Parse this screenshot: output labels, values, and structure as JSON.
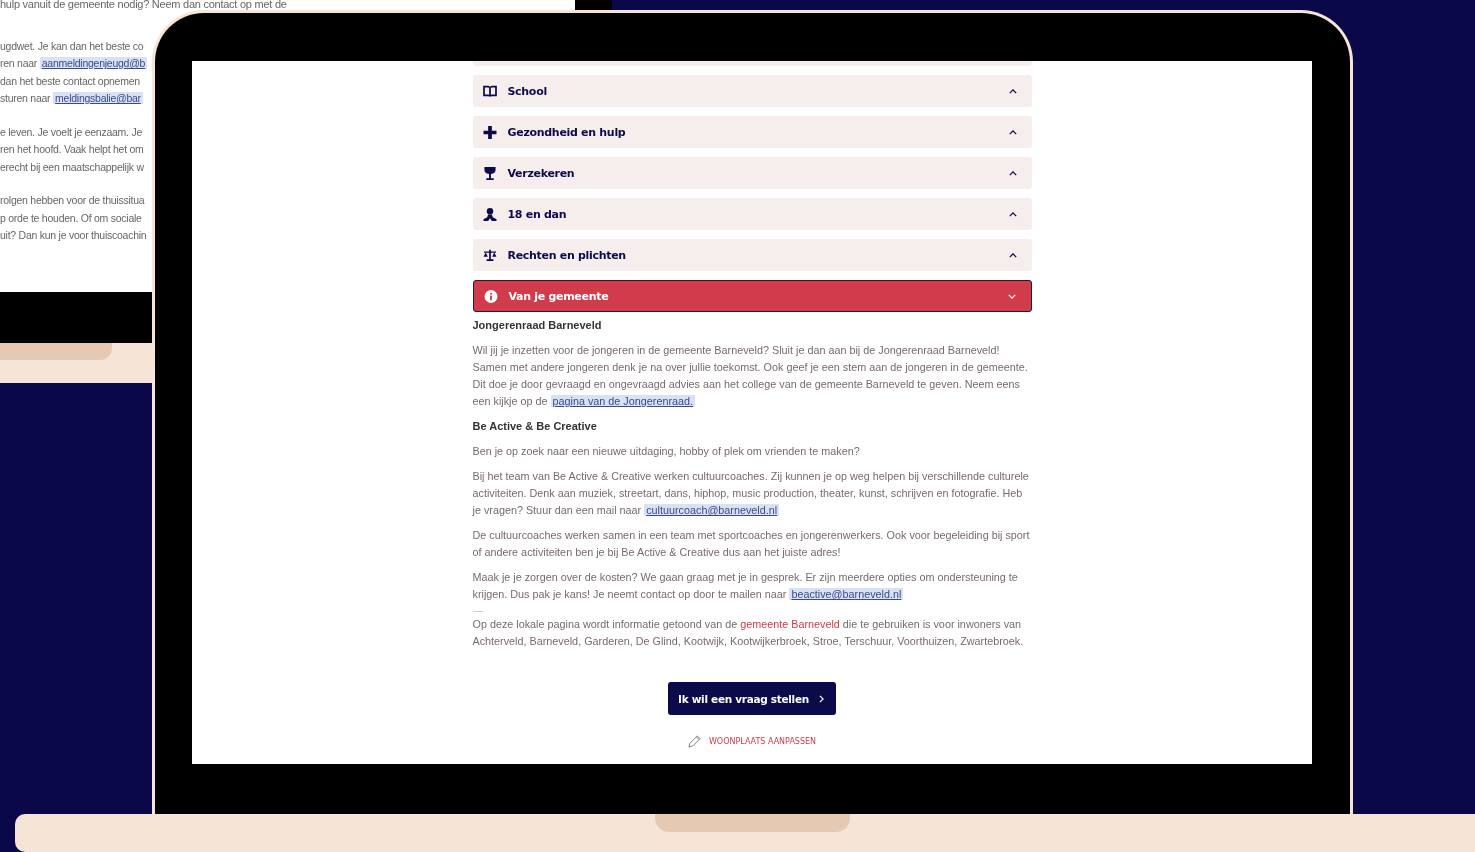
{
  "background_page": {
    "lines": [
      {
        "parts": [
          {
            "kind": "text",
            "text": "hulp vanuit de gemeente nodig? Neem dan contact op met de"
          }
        ]
      },
      {
        "parts": [
          {
            "kind": "text",
            "text": "ugdwet. Je kan dan het beste co"
          }
        ]
      },
      {
        "parts": [
          {
            "kind": "text",
            "text": "ren naar "
          },
          {
            "kind": "link",
            "text": "aanmeldingenjeugd@b"
          }
        ]
      },
      {
        "parts": [
          {
            "kind": "text",
            "text": "dan het beste contact opnemen"
          }
        ]
      },
      {
        "parts": [
          {
            "kind": "text",
            "text": "sturen naar "
          },
          {
            "kind": "link",
            "text": "meldingsbalie@bar"
          }
        ]
      },
      {
        "parts": [
          {
            "kind": "text",
            "text": "e leven. Je voelt je eenzaam. Je"
          }
        ]
      },
      {
        "parts": [
          {
            "kind": "text",
            "text": "ren het hoofd. Vaak helpt het om"
          }
        ]
      },
      {
        "parts": [
          {
            "kind": "text",
            "text": "erecht bij een maatschappelijk w"
          }
        ]
      },
      {
        "parts": [
          {
            "kind": "text",
            "text": "rolgen hebben voor de thuissitua"
          }
        ]
      },
      {
        "parts": [
          {
            "kind": "text",
            "text": "p orde te houden. Of om sociale"
          }
        ]
      },
      {
        "parts": [
          {
            "kind": "text",
            "text": "uit? Dan kun je voor thuiscoachin"
          }
        ]
      }
    ]
  },
  "accordion": [
    {
      "label": "School",
      "expanded": false
    },
    {
      "label": "Gezondheid en hulp",
      "expanded": false
    },
    {
      "label": "Verzekeren",
      "expanded": false
    },
    {
      "label": "18 en dan",
      "expanded": false
    },
    {
      "label": "Rechten en plichten",
      "expanded": false
    },
    {
      "label": "Van je gemeente",
      "expanded": true
    }
  ],
  "content": [
    {
      "kind": "heading",
      "parts": [
        {
          "kind": "text",
          "text": "Jongerenraad Barneveld"
        }
      ]
    },
    {
      "kind": "paragraph",
      "parts": [
        {
          "kind": "text",
          "text": "Wil jij je inzetten voor de jongeren in de gemeente Barneveld? Sluit je dan aan bij de Jongerenraad Barneveld! Samen met andere jongeren denk je na over jullie toekomst. Ook geef je een stem aan de jongeren in de gemeente. Dit doe je door gevraagd en ongevraagd advies aan het college van de gemeente Barneveld te geven. Neem eens een kijkje op de "
        },
        {
          "kind": "link",
          "text": "pagina  van de Jongerenraad."
        }
      ]
    },
    {
      "kind": "heading",
      "parts": [
        {
          "kind": "text",
          "text": "Be Active & Be Creative"
        }
      ]
    },
    {
      "kind": "paragraph",
      "parts": [
        {
          "kind": "text",
          "text": "Ben je op zoek naar een nieuwe uitdaging, hobby of plek om vrienden te maken?"
        }
      ]
    },
    {
      "kind": "paragraph",
      "parts": [
        {
          "kind": "text",
          "text": "Bij het team van Be Active & Creative werken cultuurcoaches. Zij kunnen je op weg helpen bij verschillende culturele activiteiten. Denk aan muziek, streetart, dans, hiphop, music production, theater, kunst, schrijven en fotografie. Heb je vragen? Stuur dan een mail naar "
        },
        {
          "kind": "link",
          "text": "cultuurcoach@barneveld.nl"
        }
      ]
    },
    {
      "kind": "paragraph",
      "parts": [
        {
          "kind": "text",
          "text": "De cultuurcoaches werken samen in een team met sportcoaches en jongerenwerkers. Ook voor begeleiding bij sport of andere activiteiten ben je bij Be Active & Creative dus aan het juiste adres!"
        }
      ]
    },
    {
      "kind": "paragraph",
      "parts": [
        {
          "kind": "text",
          "text": "Maak je je zorgen over de kosten? We gaan graag met je in gesprek. Er zijn meerdere opties om ondersteuning te krijgen. Dus pak je kans! Je neemt contact op door te mailen naar "
        },
        {
          "kind": "link",
          "text": "beactive@barneveld.nl"
        }
      ]
    },
    {
      "kind": "divider"
    },
    {
      "kind": "footnote",
      "parts": [
        {
          "kind": "text",
          "text": "Op deze lokale pagina wordt informatie getoond van de "
        },
        {
          "kind": "municipality",
          "text": "gemeente Barneveld"
        },
        {
          "kind": "text",
          "text": " die te gebruiken is voor inwoners van Achterveld, Barneveld, Garderen, De Glind, Kootwijk, Kootwijkerbroek, Stroe, Terschuur, Voorthuizen, Zwartebroek."
        }
      ]
    }
  ],
  "question_button": {
    "label": "Ik wil een vraag stellen"
  },
  "change_location_link": {
    "label": "WOONPLAATS AANPASSEN"
  }
}
